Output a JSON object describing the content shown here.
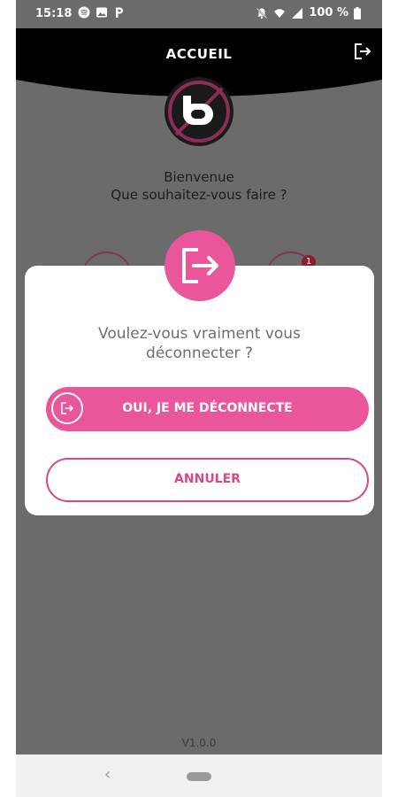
{
  "status": {
    "time": "15:18",
    "battery": "100 %"
  },
  "header": {
    "title": "ACCUEIL"
  },
  "welcome": {
    "line1": "Bienvenue",
    "line2": "Que souhaitez-vous faire ?"
  },
  "background": {
    "badge_count": "1"
  },
  "dialog": {
    "question_line1": "Voulez-vous vraiment vous",
    "question_line2": "déconnecter ?",
    "confirm_label": "OUI, JE ME DÉCONNECTE",
    "cancel_label": "ANNULER"
  },
  "footer": {
    "version": "V1.0.0"
  },
  "colors": {
    "accent": "#e9569b",
    "overlay": "#6b6b6b",
    "header": "#000000"
  }
}
